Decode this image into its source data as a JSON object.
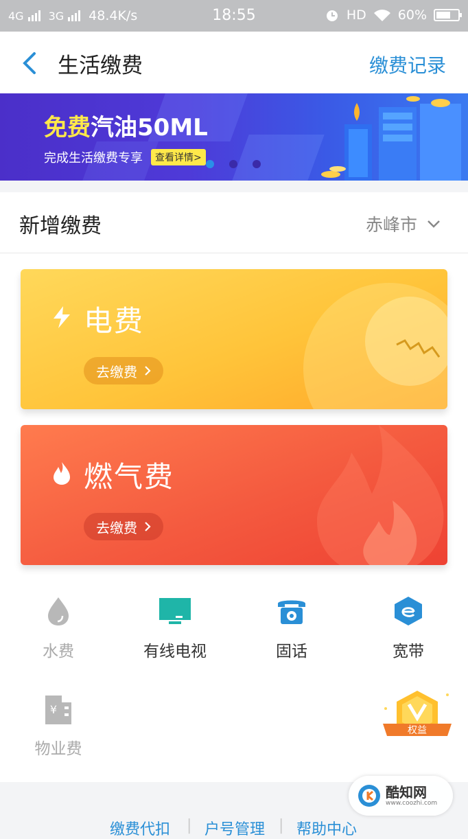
{
  "status_bar": {
    "net1": "4G",
    "net2": "3G",
    "speed": "48.4K/s",
    "time": "18:55",
    "hd": "HD",
    "battery": "60%"
  },
  "header": {
    "title": "生活缴费",
    "record_link": "缴费记录"
  },
  "banner": {
    "title_highlight": "免费",
    "title_rest": "汽油50ML",
    "subtitle": "完成生活缴费专享",
    "button": "查看详情>"
  },
  "new_payment": {
    "title": "新增缴费",
    "city": "赤峰市"
  },
  "cards": [
    {
      "title": "电费",
      "button": "去缴费"
    },
    {
      "title": "燃气费",
      "button": "去缴费"
    }
  ],
  "services": [
    {
      "label": "水费",
      "icon": "water-drop-icon"
    },
    {
      "label": "有线电视",
      "icon": "tv-icon"
    },
    {
      "label": "固话",
      "icon": "telephone-icon"
    },
    {
      "label": "宽带",
      "icon": "broadband-e-icon"
    },
    {
      "label": "物业费",
      "icon": "property-building-icon"
    }
  ],
  "vip_badge": "权益",
  "footer_links": [
    "缴费代扣",
    "户号管理",
    "帮助中心"
  ],
  "watermark": {
    "name": "酷知网",
    "url": "www.coozhi.com"
  },
  "colors": {
    "accent": "#2a8fd6",
    "electric_card": "#ffc43a",
    "gas_card": "#f45a3f",
    "tv_icon": "#1fb5a8"
  }
}
